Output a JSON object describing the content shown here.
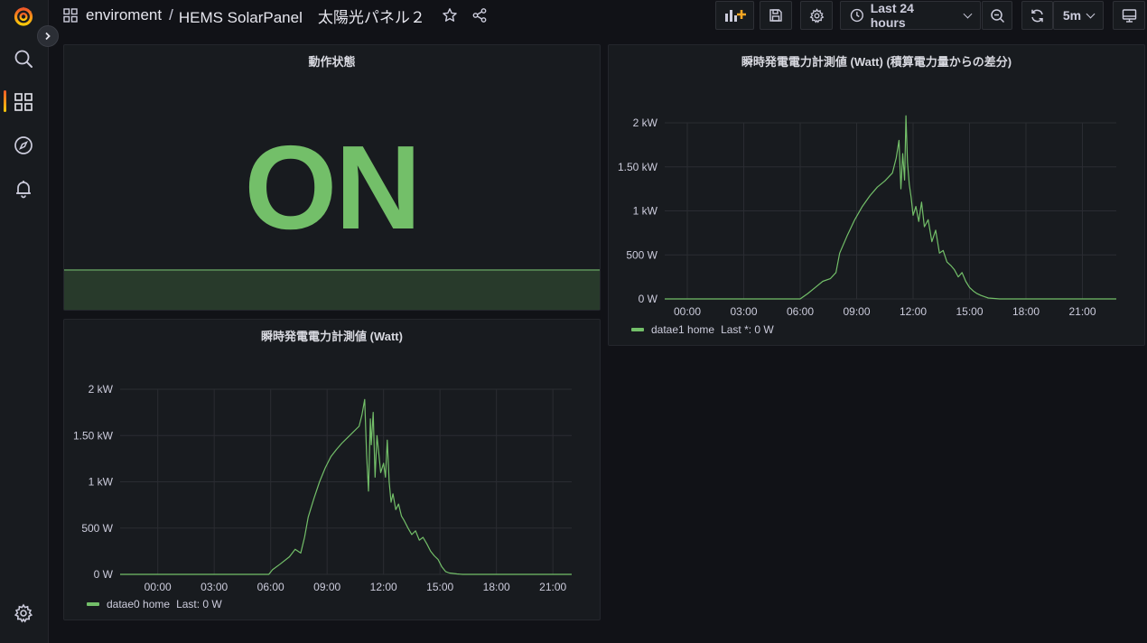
{
  "header": {
    "folder": "enviroment",
    "separator": "/",
    "dashboard_title": "HEMS SolarPanel　太陽光パネル２",
    "time_range": "Last 24 hours",
    "refresh_interval": "5m"
  },
  "colors": {
    "accent": "#73bf69",
    "background": "#111217",
    "panel": "#181b1f"
  },
  "sidebar": {
    "icons": [
      "grafana-logo-icon",
      "search-icon",
      "dashboards-icon",
      "explore-icon",
      "alerting-icon",
      "configuration-icon"
    ]
  },
  "panels": {
    "status": {
      "title": "動作状態",
      "value": "ON",
      "color": "#73bf69"
    },
    "chart_main": {
      "title": "瞬時発電電力計測値 (Watt)",
      "legend": {
        "series": "datae0 home",
        "last": "Last: 0 W"
      }
    },
    "chart_diff": {
      "title": "瞬時発電電力計測値 (Watt) (積算電力量からの差分)",
      "legend": {
        "series": "datae1 home",
        "last": "Last *: 0 W"
      }
    }
  },
  "chart_data": [
    {
      "type": "line",
      "title": "瞬時発電電力計測値 (Watt)",
      "xlabel": "",
      "ylabel": "",
      "x_ticks": [
        "00:00",
        "03:00",
        "06:00",
        "09:00",
        "12:00",
        "15:00",
        "18:00",
        "21:00"
      ],
      "y_ticks": [
        "0 W",
        "500 W",
        "1 kW",
        "1.50 kW",
        "2 kW"
      ],
      "xlim_hours": [
        -2.0,
        22.0
      ],
      "ylim": [
        0,
        2000
      ],
      "grid": true,
      "series": [
        {
          "name": "datae0 home",
          "color": "#73bf69",
          "x_hours": [
            -2.0,
            5.9,
            6.1,
            6.5,
            7.0,
            7.3,
            7.6,
            7.8,
            8.0,
            8.3,
            8.6,
            8.9,
            9.2,
            9.5,
            9.8,
            10.1,
            10.4,
            10.7,
            10.85,
            11.0,
            11.1,
            11.2,
            11.3,
            11.35,
            11.45,
            11.55,
            11.65,
            11.75,
            11.85,
            12.0,
            12.1,
            12.2,
            12.3,
            12.4,
            12.5,
            12.65,
            12.8,
            12.95,
            13.1,
            13.3,
            13.5,
            13.7,
            13.9,
            14.1,
            14.3,
            14.5,
            14.7,
            14.9,
            15.1,
            15.3,
            15.5,
            15.7,
            15.9,
            16.2,
            16.5,
            22.0
          ],
          "y_values": [
            0,
            0,
            50,
            110,
            190,
            270,
            230,
            400,
            620,
            820,
            1000,
            1150,
            1270,
            1350,
            1420,
            1480,
            1540,
            1600,
            1720,
            1890,
            1300,
            900,
            1680,
            1400,
            1750,
            1050,
            1500,
            1300,
            1100,
            1200,
            1050,
            1450,
            1000,
            780,
            870,
            700,
            760,
            630,
            580,
            500,
            430,
            470,
            370,
            400,
            330,
            250,
            200,
            160,
            80,
            30,
            15,
            10,
            5,
            0,
            0,
            0
          ]
        }
      ]
    },
    {
      "type": "line",
      "title": "瞬時発電電力計測値 (Watt) (積算電力量からの差分)",
      "xlabel": "",
      "ylabel": "",
      "x_ticks": [
        "00:00",
        "03:00",
        "06:00",
        "09:00",
        "12:00",
        "15:00",
        "18:00",
        "21:00"
      ],
      "y_ticks": [
        "0 W",
        "500 W",
        "1 kW",
        "1.50 kW",
        "2 kW"
      ],
      "xlim_hours": [
        -1.2,
        22.8
      ],
      "ylim": [
        0,
        2000
      ],
      "grid": true,
      "series": [
        {
          "name": "datae1 home",
          "color": "#73bf69",
          "x_hours": [
            -1.2,
            6.0,
            6.4,
            6.8,
            7.2,
            7.6,
            7.9,
            8.1,
            8.5,
            8.9,
            9.3,
            9.7,
            10.1,
            10.5,
            10.9,
            11.1,
            11.25,
            11.35,
            11.45,
            11.55,
            11.62,
            11.7,
            11.8,
            11.9,
            12.0,
            12.15,
            12.3,
            12.45,
            12.6,
            12.8,
            13.0,
            13.2,
            13.4,
            13.6,
            13.8,
            14.0,
            14.2,
            14.4,
            14.6,
            14.8,
            15.0,
            15.2,
            15.4,
            15.6,
            15.8,
            16.0,
            16.3,
            16.6,
            17.0,
            22.8
          ],
          "y_values": [
            0,
            0,
            60,
            130,
            200,
            230,
            300,
            520,
            720,
            900,
            1050,
            1170,
            1270,
            1340,
            1430,
            1600,
            1800,
            1250,
            1650,
            1350,
            2080,
            1550,
            1300,
            1150,
            950,
            1050,
            880,
            1100,
            820,
            900,
            650,
            780,
            520,
            550,
            420,
            380,
            330,
            250,
            300,
            200,
            130,
            90,
            60,
            40,
            25,
            10,
            5,
            0,
            0,
            0
          ]
        }
      ]
    }
  ]
}
